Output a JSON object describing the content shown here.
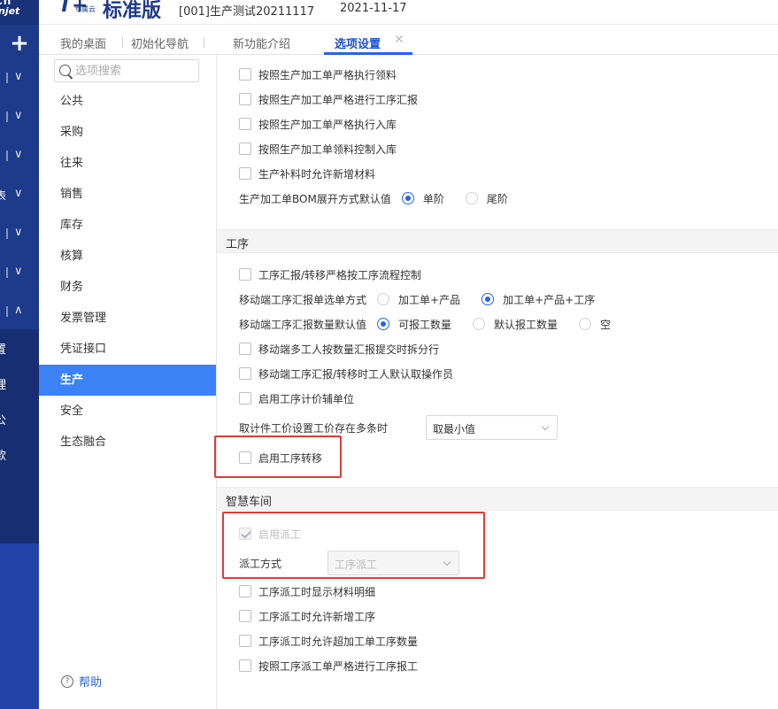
{
  "app": {
    "brand_prefix": "T+",
    "brand_sub": "专属云",
    "brand_name": "标准版",
    "account": "[001]生产测试20211117",
    "date": "2021-11-17",
    "rail_logo_top": "Ch",
    "rail_logo_text": "njet",
    "rail_plus": "+",
    "rail_cut_label": "表",
    "rail_sub_items": [
      "置",
      "理",
      "公",
      "款"
    ]
  },
  "tabs": [
    {
      "label": "我的桌面"
    },
    {
      "label": "初始化导航"
    },
    {
      "label": "新功能介绍"
    },
    {
      "label": "选项设置",
      "active": true
    }
  ],
  "sidebar": {
    "search_placeholder": "选项搜索",
    "items": [
      "公共",
      "采购",
      "往来",
      "销售",
      "库存",
      "核算",
      "财务",
      "发票管理",
      "凭证接口",
      "生产",
      "安全",
      "生态融合"
    ],
    "active_index": 9,
    "help_label": "帮助"
  },
  "content": {
    "top_options": [
      "按照生产加工单严格执行领料",
      "按照生产加工单严格进行工序汇报",
      "按照生产加工单严格执行入库",
      "按照生产加工单领料控制入库",
      "生产补料时允许新增材料"
    ],
    "bom": {
      "label": "生产加工单BOM展开方式默认值",
      "options": [
        "单阶",
        "尾阶"
      ],
      "selected": 0
    },
    "section_process": "工序",
    "process_opt1": "工序汇报/转移严格按工序流程控制",
    "mobile_select": {
      "label": "移动端工序汇报单选单方式",
      "options": [
        "加工单+产品",
        "加工单+产品+工序"
      ],
      "selected": 1
    },
    "mobile_qty": {
      "label": "移动端工序汇报数量默认值",
      "options": [
        "可报工数量",
        "默认报工数量",
        "空"
      ],
      "selected": 0
    },
    "process_opts": [
      "移动端多工人按数量汇报提交时拆分行",
      "移动端工序汇报/转移时工人默认取操作员",
      "启用工序计价辅单位"
    ],
    "piece_price": {
      "label": "取计件工价设置工价存在多条时",
      "value": "取最小值"
    },
    "enable_transfer": "启用工序转移",
    "section_workshop": "智慧车间",
    "enable_dispatch": "启用派工",
    "dispatch_mode": {
      "label": "派工方式",
      "value": "工序派工"
    },
    "workshop_opts": [
      "工序派工时显示材料明细",
      "工序派工时允许新增工序",
      "工序派工时允许超加工单工序数量",
      "按照工序派工单严格进行工序报工"
    ]
  },
  "colors": {
    "rail": "#1e3a8a",
    "accent": "#2563eb",
    "sidebar_active": "#3b82f6",
    "highlight": "#e53935"
  }
}
